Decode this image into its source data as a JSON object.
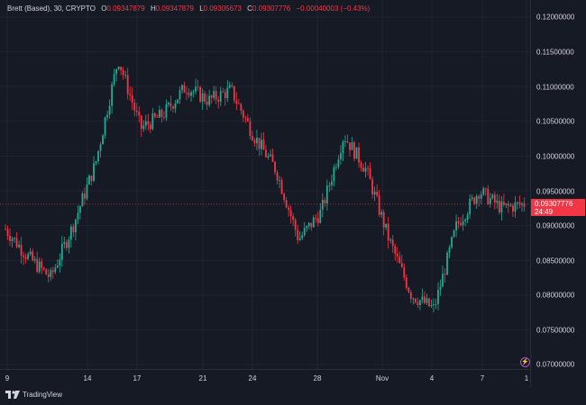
{
  "legend": {
    "symbol": "Brett (Based), 30, CRYPTO",
    "open_label": "O",
    "open": "0.09347879",
    "high_label": "H",
    "high": "0.09347879",
    "low_label": "L",
    "low": "0.09305673",
    "close_label": "C",
    "close": "0.09307776",
    "change": "−0.00040003 (−0.43%)"
  },
  "price_scale": {
    "ticks": [
      "0.12000000",
      "0.11500000",
      "0.11000000",
      "0.10500000",
      "0.10000000",
      "0.09500000",
      "0.09000000",
      "0.08500000",
      "0.08000000",
      "0.07500000",
      "0.07000000"
    ],
    "current_price": "0.09307776",
    "countdown": "24:49"
  },
  "time_scale": {
    "ticks": [
      "9",
      "14",
      "17",
      "21",
      "24",
      "28",
      "Nov",
      "4",
      "7",
      "1"
    ]
  },
  "footer": {
    "brand": "TradingView"
  },
  "icons": {
    "logo": "tradingview-logo-icon",
    "bolt": "lightning-icon"
  },
  "colors": {
    "up": "#22ab94",
    "down": "#f23645",
    "background": "#161a25",
    "grid": "#1f2430",
    "accent": "#b24ed1"
  },
  "chart_data": {
    "type": "line",
    "title": "Brett (Based), 30, CRYPTO",
    "xlabel": "",
    "ylabel": "",
    "ylim": [
      0.07,
      0.12
    ],
    "x": [
      "9",
      "",
      "",
      "",
      "",
      "14",
      "",
      "17",
      "",
      "",
      "21",
      "",
      "24",
      "",
      "",
      "28",
      "",
      "Nov",
      "",
      "4",
      "",
      "7",
      "",
      "1"
    ],
    "series": [
      {
        "values": [
          0.0895,
          0.0855,
          0.0825,
          0.09,
          0.099,
          0.114,
          0.104,
          0.106,
          0.11,
          0.108,
          0.1095,
          0.103,
          0.098,
          0.088,
          0.092,
          0.103,
          0.098,
          0.088,
          0.08,
          0.078,
          0.09,
          0.095,
          0.0925,
          0.0931
        ]
      }
    ],
    "current": 0.09307776,
    "grid": true
  }
}
